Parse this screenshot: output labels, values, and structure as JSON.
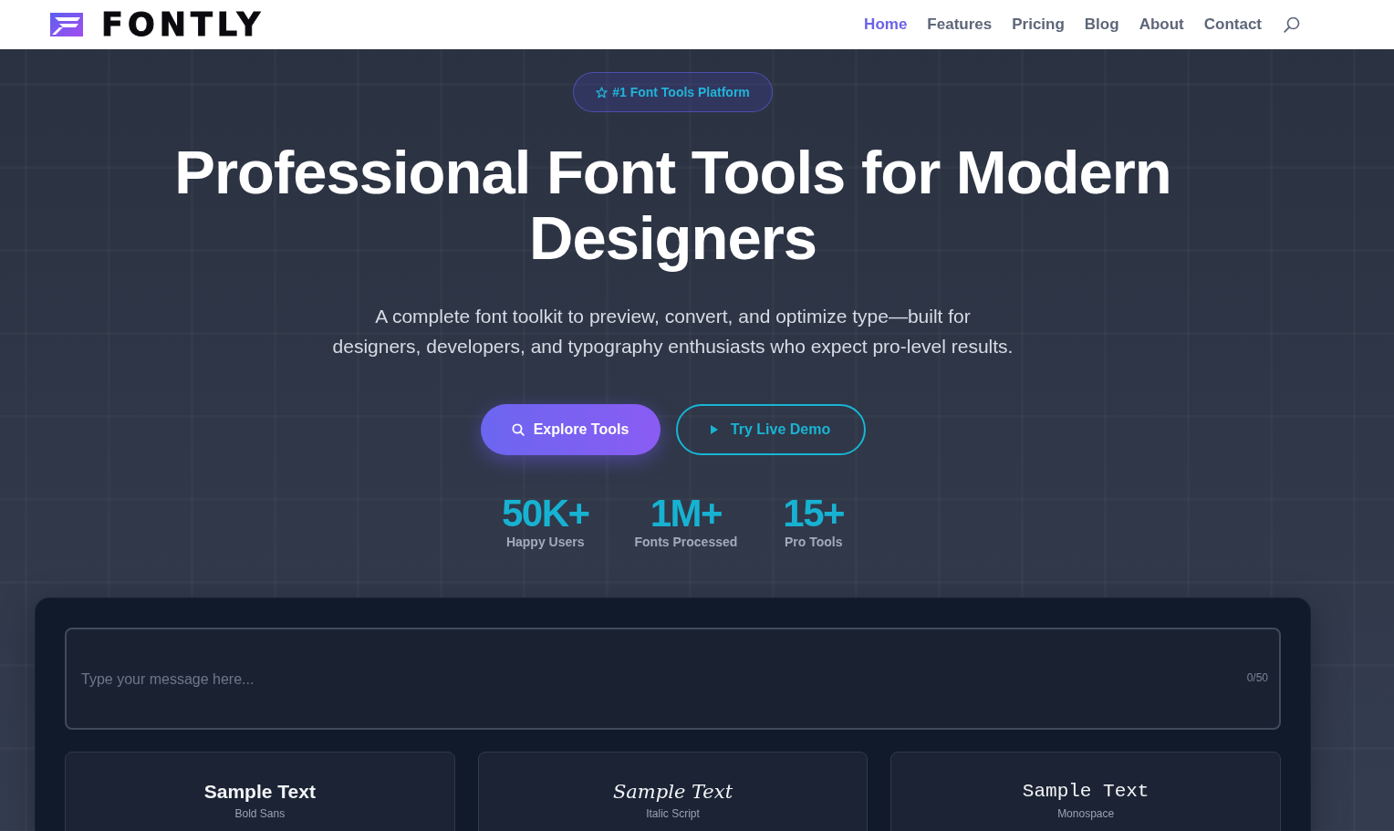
{
  "header": {
    "logo": "FONTLY",
    "nav": [
      {
        "label": "Home",
        "selected": true
      },
      {
        "label": "Features",
        "selected": false
      },
      {
        "label": "Pricing",
        "selected": false
      },
      {
        "label": "Blog",
        "selected": false
      },
      {
        "label": "About",
        "selected": false
      },
      {
        "label": "Contact",
        "selected": false
      }
    ]
  },
  "hero": {
    "badge": "#1 Font Tools Platform",
    "title": "Professional Font Tools for Modern Designers",
    "subtitle": "A complete font toolkit to preview, convert, and optimize type—built for designers, developers, and typography enthusiasts who expect pro-level results.",
    "buttons": [
      {
        "label": "Explore Tools",
        "kind": "primary"
      },
      {
        "label": "Try Live Demo",
        "kind": "outline"
      }
    ],
    "stats": [
      {
        "value": "50K+",
        "label": "Happy Users"
      },
      {
        "value": "1M+",
        "label": "Fonts Processed"
      },
      {
        "value": "15+",
        "label": "Pro Tools"
      }
    ]
  },
  "playground": {
    "input": {
      "placeholder": "Type your message here...",
      "counter": "0/50"
    },
    "samples": [
      {
        "text": "Sample Text",
        "style": "Bold Sans",
        "kind": "bold"
      },
      {
        "text": "Sample Text",
        "style": "Italic Script",
        "kind": "italic"
      },
      {
        "text": "Sample Text",
        "style": "Monospace",
        "kind": "mono"
      }
    ]
  }
}
